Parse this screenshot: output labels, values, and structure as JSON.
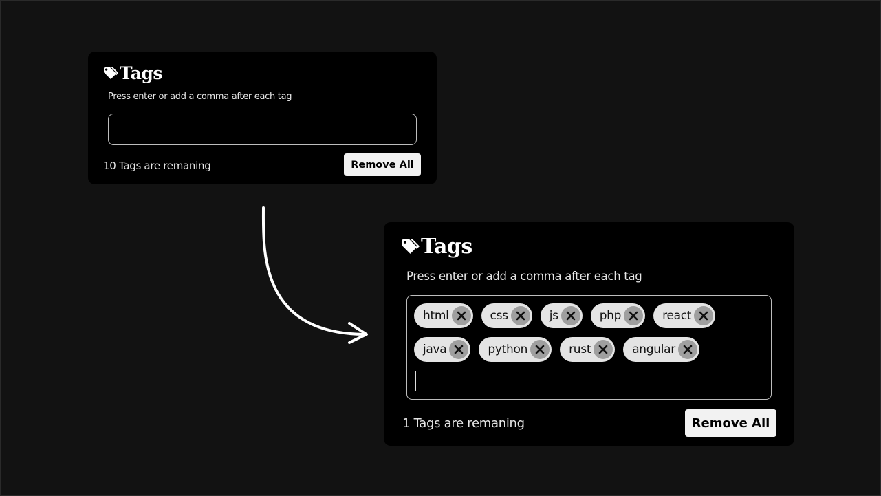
{
  "before_card": {
    "title": "Tags",
    "hint": "Press enter or add a comma after each tag",
    "input_value": "",
    "remaining": "10 Tags are remaning",
    "remove_all_label": "Remove All"
  },
  "after_card": {
    "title": "Tags",
    "hint": "Press enter or add a comma after each tag",
    "tags": [
      "html",
      "css",
      "js",
      "php",
      "react",
      "java",
      "python",
      "rust",
      "angular"
    ],
    "remaining": "1 Tags are remaning",
    "remove_all_label": "Remove All"
  },
  "icons": {
    "title_icon": "tag-icon",
    "tag_remove_icon": "close-icon",
    "transition": "curved-arrow-icon"
  },
  "colors": {
    "page_background": "#121212",
    "card_background": "#000000",
    "tag_background": "#e4e4e4",
    "tag_close_background": "#9f9f9f",
    "button_background": "#f2f2f2"
  }
}
